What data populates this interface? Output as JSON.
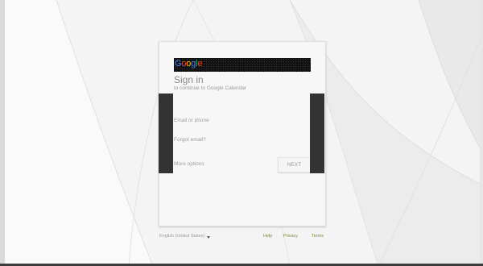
{
  "brand": {
    "logo_letters": [
      "G",
      "o",
      "o",
      "g",
      "l",
      "e"
    ]
  },
  "signin": {
    "title": "Sign in",
    "subtitle": "to continue to Google Calendar",
    "email_placeholder": "Email or phone",
    "forgot_email": "Forgot email?",
    "more_options": "More options",
    "next_label": "NEXT"
  },
  "footer": {
    "language": "English (United States)",
    "help": "Help",
    "privacy": "Privacy",
    "terms": "Terms"
  },
  "colors": {
    "google_blue": "#4285f4",
    "google_red": "#ea4335",
    "google_yellow": "#fbbc05",
    "google_green": "#34a853"
  }
}
